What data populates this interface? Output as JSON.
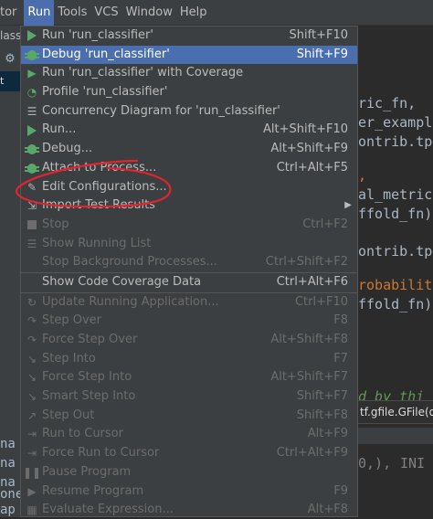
{
  "menubar": {
    "items": [
      {
        "label": "tor"
      },
      {
        "label": "Run",
        "active": true
      },
      {
        "label": "Tools"
      },
      {
        "label": "VCS"
      },
      {
        "label": "Window"
      },
      {
        "label": "Help"
      }
    ]
  },
  "left": {
    "top_label": "lassi",
    "sel_label": "t",
    "items": [
      "na",
      "na",
      "na",
      "one",
      "ap"
    ]
  },
  "code": {
    "lines": [
      "ric_fn,",
      "er_example",
      "ontrib.tpu",
      ",",
      "al_metric",
      "ffold_fn)",
      "ontrib.tpu",
      "robabilit",
      "ffold_fn)",
      "d by thi",
      "0,),",
      "INI"
    ],
    "tooltip": "tf.gfile.GFile(o"
  },
  "menu": {
    "items": [
      {
        "label": "Run 'run_classifier'",
        "shortcut": "Shift+F10",
        "icon": "run-icon"
      },
      {
        "label": "Debug 'run_classifier'",
        "shortcut": "Shift+F9",
        "icon": "debug-icon",
        "selected": true
      },
      {
        "label": "Run 'run_classifier' with Coverage",
        "shortcut": "",
        "icon": "coverage-icon"
      },
      {
        "label": "Profile 'run_classifier'",
        "shortcut": "",
        "icon": "profile-icon"
      },
      {
        "label": "Concurrency Diagram for 'run_classifier'",
        "shortcut": "",
        "icon": "concurrency-icon"
      },
      {
        "label": "Run...",
        "shortcut": "Alt+Shift+F10",
        "icon": "run-icon"
      },
      {
        "label": "Debug...",
        "shortcut": "Alt+Shift+F9",
        "icon": "debug-icon"
      },
      {
        "label": "Attach to Process...",
        "shortcut": "Ctrl+Alt+F5",
        "icon": "attach-icon"
      },
      {
        "label": "Edit Configurations...",
        "shortcut": "",
        "icon": "edit-icon"
      },
      {
        "label": "Import Test Results",
        "shortcut": "",
        "icon": "import-icon",
        "submenu": true
      },
      {
        "label": "Stop",
        "shortcut": "Ctrl+F2",
        "icon": "stop-icon",
        "disabled": true
      },
      {
        "label": "Show Running List",
        "shortcut": "",
        "icon": "list-icon",
        "disabled": true
      },
      {
        "label": "Stop Background Processes...",
        "shortcut": "Ctrl+Shift+F2",
        "icon": "",
        "disabled": true
      },
      {
        "label": "Show Code Coverage Data",
        "shortcut": "Ctrl+Alt+F6",
        "icon": ""
      },
      {
        "label": "Update Running Application...",
        "shortcut": "Ctrl+F10",
        "icon": "update-icon",
        "disabled": true
      },
      {
        "label": "Step Over",
        "shortcut": "F8",
        "icon": "step-over-icon",
        "disabled": true
      },
      {
        "label": "Force Step Over",
        "shortcut": "Alt+Shift+F8",
        "icon": "force-step-over-icon",
        "disabled": true
      },
      {
        "label": "Step Into",
        "shortcut": "F7",
        "icon": "step-into-icon",
        "disabled": true
      },
      {
        "label": "Force Step Into",
        "shortcut": "Alt+Shift+F7",
        "icon": "force-step-into-icon",
        "disabled": true
      },
      {
        "label": "Smart Step Into",
        "shortcut": "Shift+F7",
        "icon": "smart-step-into-icon",
        "disabled": true
      },
      {
        "label": "Step Out",
        "shortcut": "Shift+F8",
        "icon": "step-out-icon",
        "disabled": true
      },
      {
        "label": "Run to Cursor",
        "shortcut": "Alt+F9",
        "icon": "run-to-cursor-icon",
        "disabled": true
      },
      {
        "label": "Force Run to Cursor",
        "shortcut": "Ctrl+Alt+F9",
        "icon": "force-run-to-cursor-icon",
        "disabled": true
      },
      {
        "label": "Pause Program",
        "shortcut": "",
        "icon": "pause-icon",
        "disabled": true
      },
      {
        "label": "Resume Program",
        "shortcut": "F9",
        "icon": "resume-icon",
        "disabled": true
      },
      {
        "label": "Evaluate Expression...",
        "shortcut": "Alt+F8",
        "icon": "evaluate-icon",
        "disabled": true
      }
    ]
  },
  "colors": {
    "menu_bg": "#3c3f41",
    "selection": "#4b6eaf",
    "annotation": "#e0252c"
  }
}
